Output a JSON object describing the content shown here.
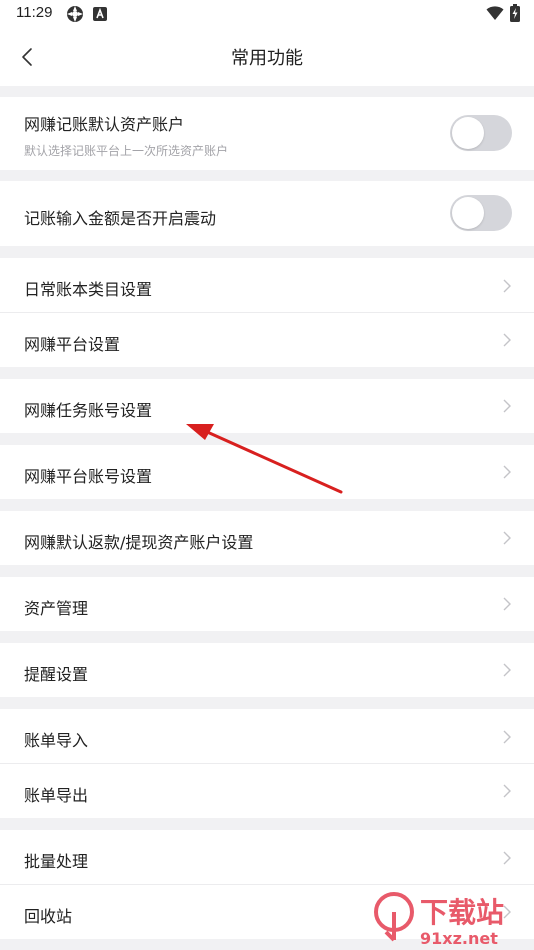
{
  "status_bar": {
    "time": "11:29"
  },
  "header": {
    "title": "常用功能"
  },
  "toggles": [
    {
      "title": "网赚记账默认资产账户",
      "subtitle": "默认选择记账平台上一次所选资产账户",
      "on": false
    },
    {
      "title": "记账输入金额是否开启震动",
      "on": false
    }
  ],
  "menu": [
    {
      "label": "日常账本类目设置"
    },
    {
      "label": "网赚平台设置"
    },
    {
      "label": "网赚任务账号设置"
    },
    {
      "label": "网赚平台账号设置"
    },
    {
      "label": "网赚默认返款/提现资产账户设置"
    },
    {
      "label": "资产管理"
    },
    {
      "label": "提醒设置"
    },
    {
      "label": "账单导入"
    },
    {
      "label": "账单导出"
    },
    {
      "label": "批量处理"
    },
    {
      "label": "回收站"
    }
  ],
  "colors": {
    "background": "#f1f1f3",
    "toggle_off": "#d5d6db",
    "annotation_arrow": "#d8201f",
    "chevron": "#c4c4c8"
  },
  "watermark": {
    "line1": "下载站",
    "line2": "91xz.net"
  }
}
